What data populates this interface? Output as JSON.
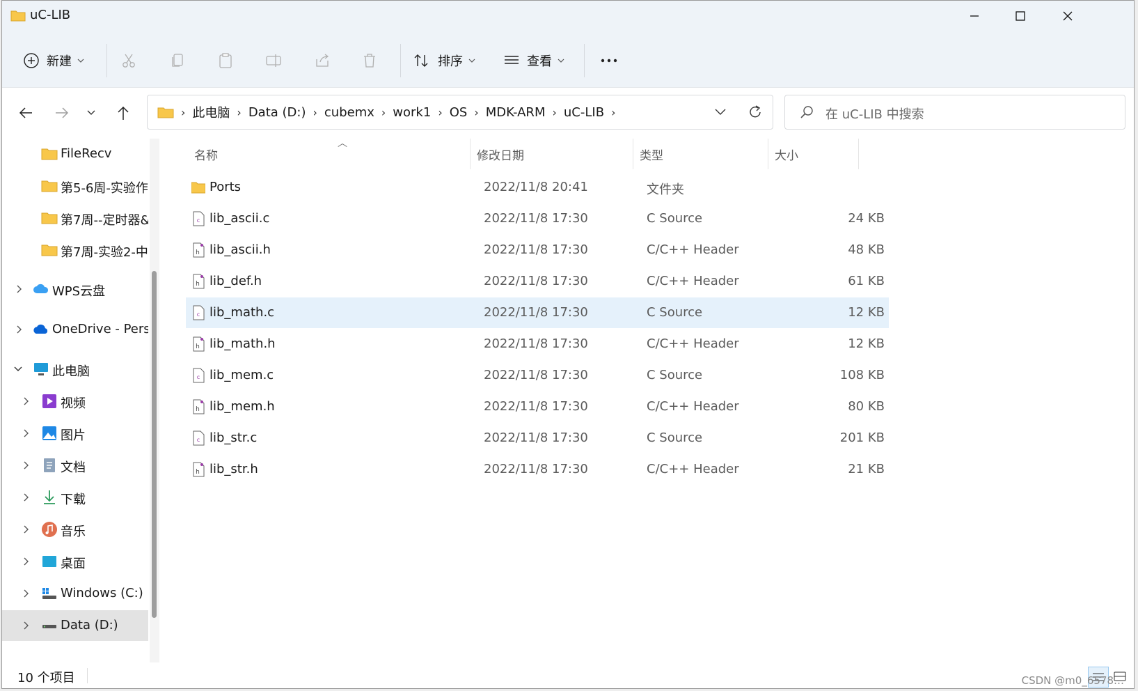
{
  "window": {
    "title": "uC-LIB"
  },
  "toolbar": {
    "new_label": "新建",
    "sort_label": "排序",
    "view_label": "查看",
    "more_label": "..."
  },
  "address": {
    "crumbs": [
      "此电脑",
      "Data (D:)",
      "cubemx",
      "work1",
      "OS",
      "MDK-ARM",
      "uC-LIB"
    ],
    "search_placeholder": "在 uC-LIB 中搜索"
  },
  "sidebar": {
    "items": [
      {
        "label": "FileRecv",
        "icon": "folder-icon"
      },
      {
        "label": "第5-6周-实验作",
        "icon": "folder-icon"
      },
      {
        "label": "第7周--定时器&",
        "icon": "folder-icon"
      },
      {
        "label": "第7周-实验2-中",
        "icon": "folder-icon"
      },
      {
        "label": "WPS云盘",
        "icon": "cloud-icon"
      },
      {
        "label": "OneDrive - Pers",
        "icon": "onedrive-icon"
      },
      {
        "label": "此电脑",
        "icon": "pc-icon"
      },
      {
        "label": "视频",
        "icon": "video-icon"
      },
      {
        "label": "图片",
        "icon": "pictures-icon"
      },
      {
        "label": "文档",
        "icon": "documents-icon"
      },
      {
        "label": "下载",
        "icon": "download-icon"
      },
      {
        "label": "音乐",
        "icon": "music-icon"
      },
      {
        "label": "桌面",
        "icon": "desktop-icon"
      },
      {
        "label": "Windows (C:)",
        "icon": "drive-c-icon"
      },
      {
        "label": "Data (D:)",
        "icon": "drive-d-icon"
      }
    ]
  },
  "columns": {
    "name": "名称",
    "date": "修改日期",
    "type": "类型",
    "size": "大小"
  },
  "files": [
    {
      "name": "Ports",
      "date": "2022/11/8 20:41",
      "type": "文件夹",
      "size": "",
      "icon": "folder-icon"
    },
    {
      "name": "lib_ascii.c",
      "date": "2022/11/8 17:30",
      "type": "C Source",
      "size": "24 KB",
      "icon": "c-source-icon"
    },
    {
      "name": "lib_ascii.h",
      "date": "2022/11/8 17:30",
      "type": "C/C++ Header",
      "size": "48 KB",
      "icon": "c-header-icon"
    },
    {
      "name": "lib_def.h",
      "date": "2022/11/8 17:30",
      "type": "C/C++ Header",
      "size": "61 KB",
      "icon": "c-header-icon"
    },
    {
      "name": "lib_math.c",
      "date": "2022/11/8 17:30",
      "type": "C Source",
      "size": "12 KB",
      "icon": "c-source-icon",
      "selected": true
    },
    {
      "name": "lib_math.h",
      "date": "2022/11/8 17:30",
      "type": "C/C++ Header",
      "size": "12 KB",
      "icon": "c-header-icon"
    },
    {
      "name": "lib_mem.c",
      "date": "2022/11/8 17:30",
      "type": "C Source",
      "size": "108 KB",
      "icon": "c-source-icon"
    },
    {
      "name": "lib_mem.h",
      "date": "2022/11/8 17:30",
      "type": "C/C++ Header",
      "size": "80 KB",
      "icon": "c-header-icon"
    },
    {
      "name": "lib_str.c",
      "date": "2022/11/8 17:30",
      "type": "C Source",
      "size": "201 KB",
      "icon": "c-source-icon"
    },
    {
      "name": "lib_str.h",
      "date": "2022/11/8 17:30",
      "type": "C/C++ Header",
      "size": "21 KB",
      "icon": "c-header-icon"
    }
  ],
  "status": {
    "count_text": "10 个项目"
  },
  "watermark": "CSDN @m0_6578…",
  "colors": {
    "accent": "#0067c0",
    "selection": "#e5f1fb",
    "folder": "#f8c74a"
  }
}
